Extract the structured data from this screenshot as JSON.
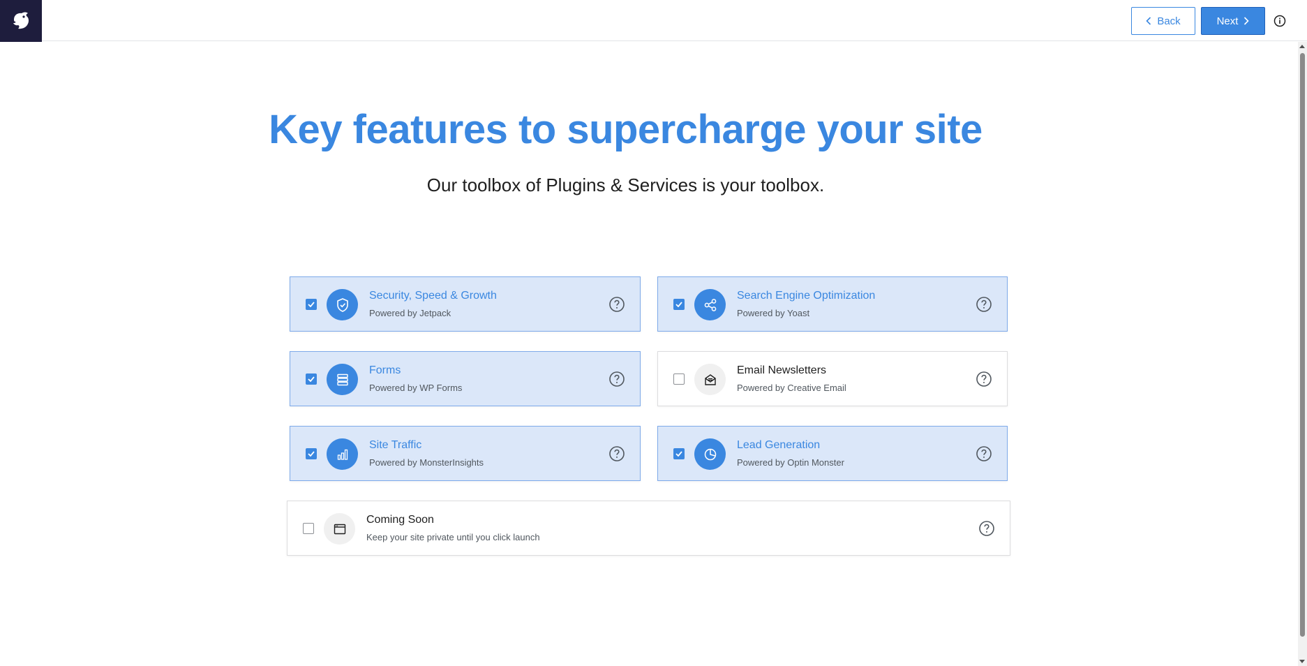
{
  "header": {
    "back_label": "Back",
    "next_label": "Next"
  },
  "main": {
    "title": "Key features to supercharge your site",
    "subtitle": "Our toolbox of Plugins & Services is your toolbox."
  },
  "features": [
    {
      "title": "Security, Speed & Growth",
      "subtitle": "Powered by Jetpack",
      "checked": true,
      "icon": "shield-icon"
    },
    {
      "title": "Search Engine Optimization",
      "subtitle": "Powered by Yoast",
      "checked": true,
      "icon": "share-icon"
    },
    {
      "title": "Forms",
      "subtitle": "Powered by WP Forms",
      "checked": true,
      "icon": "form-list-icon"
    },
    {
      "title": "Email Newsletters",
      "subtitle": "Powered by Creative Email",
      "checked": false,
      "icon": "envelope-icon"
    },
    {
      "title": "Site Traffic",
      "subtitle": "Powered by MonsterInsights",
      "checked": true,
      "icon": "bar-chart-icon"
    },
    {
      "title": "Lead Generation",
      "subtitle": "Powered by Optin Monster",
      "checked": true,
      "icon": "pie-chart-icon"
    },
    {
      "title": "Coming Soon",
      "subtitle": "Keep your site private until you click launch",
      "checked": false,
      "icon": "browser-window-icon"
    }
  ],
  "colors": {
    "accent": "#3a87e0",
    "selected_bg": "#dbe7f9",
    "logo_bg": "#1e1d3d"
  }
}
